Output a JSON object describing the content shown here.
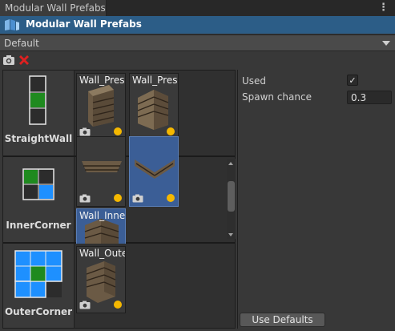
{
  "window": {
    "tab_label": "Modular Wall Prefabs",
    "menu_glyph": "⋮",
    "header_title": "Modular Wall Prefabs"
  },
  "preset": {
    "selected": "Default"
  },
  "toolbar": {
    "camera_icon": "camera-icon",
    "close_icon": "red-x-icon"
  },
  "categories": [
    {
      "label": "StraightWall",
      "thumbs": [
        {
          "name": "Wall_Prese"
        },
        {
          "name": "Wall_Prese"
        }
      ]
    },
    {
      "label": "InnerCorner",
      "thumbs": [
        {
          "name": ""
        },
        {
          "name": ""
        },
        {
          "name": "Wall_Inner_"
        }
      ]
    },
    {
      "label": "OuterCorner",
      "thumbs": [
        {
          "name": "Wall_Outer_"
        }
      ]
    }
  ],
  "inspector": {
    "used_label": "Used",
    "used_checked": true,
    "used_check_glyph": "✓",
    "spawn_label": "Spawn chance",
    "spawn_value": "0.3",
    "use_defaults_label": "Use Defaults"
  },
  "colors": {
    "header_bg": "#2c5d87",
    "accent_green": "#1f8a1f",
    "accent_blue": "#1e90ff",
    "status_dot": "#f5b800",
    "close_red": "#e02020"
  }
}
